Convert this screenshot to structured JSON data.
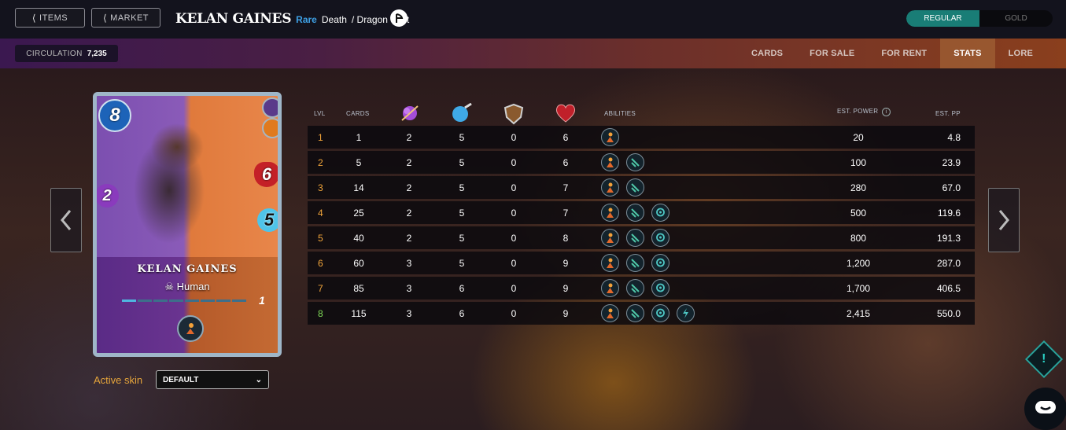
{
  "nav": {
    "items_label": "ITEMS",
    "market_label": "MARKET"
  },
  "card_header": {
    "name": "KELAN GAINES",
    "rarity": "Rare",
    "splinter": "Death",
    "secondary_splinter": "/ Dragon",
    "type": "Unit"
  },
  "edition_toggle": {
    "regular_label": "REGULAR",
    "gold_label": "GOLD",
    "selected": "REGULAR"
  },
  "circulation": {
    "label": "CIRCULATION",
    "value": "7,235"
  },
  "tabs": [
    {
      "label": "CARDS",
      "active": false
    },
    {
      "label": "FOR SALE",
      "active": false
    },
    {
      "label": "FOR RENT",
      "active": false
    },
    {
      "label": "STATS",
      "active": true
    },
    {
      "label": "LORE",
      "active": false
    }
  ],
  "card": {
    "name": "KELAN GAINES",
    "race": "Human",
    "mana": "8",
    "attack": "2",
    "health": "6",
    "speed": "5",
    "level": "1"
  },
  "skin": {
    "label": "Active skin",
    "value": "DEFAULT"
  },
  "table": {
    "headers": {
      "lvl": "LVL",
      "cards": "CARDS",
      "abilities": "ABILITIES",
      "est_power": "EST. POWER",
      "est_pp": "EST. PP"
    },
    "level_colors": [
      "#f0a43a",
      "#f0a43a",
      "#f0a43a",
      "#f0a43a",
      "#f0a43a",
      "#f0a43a",
      "#f0a43a",
      "#7ed957"
    ],
    "rows": [
      {
        "lvl": "1",
        "cards": "1",
        "mana": "2",
        "speed": "5",
        "armor": "0",
        "health": "6",
        "abilities": [
          "ability-a"
        ],
        "power": "20",
        "pp": "4.8"
      },
      {
        "lvl": "2",
        "cards": "5",
        "mana": "2",
        "speed": "5",
        "armor": "0",
        "health": "6",
        "abilities": [
          "ability-a",
          "ability-b"
        ],
        "power": "100",
        "pp": "23.9"
      },
      {
        "lvl": "3",
        "cards": "14",
        "mana": "2",
        "speed": "5",
        "armor": "0",
        "health": "7",
        "abilities": [
          "ability-a",
          "ability-b"
        ],
        "power": "280",
        "pp": "67.0"
      },
      {
        "lvl": "4",
        "cards": "25",
        "mana": "2",
        "speed": "5",
        "armor": "0",
        "health": "7",
        "abilities": [
          "ability-a",
          "ability-b",
          "ability-c"
        ],
        "power": "500",
        "pp": "119.6"
      },
      {
        "lvl": "5",
        "cards": "40",
        "mana": "2",
        "speed": "5",
        "armor": "0",
        "health": "8",
        "abilities": [
          "ability-a",
          "ability-b",
          "ability-c"
        ],
        "power": "800",
        "pp": "191.3"
      },
      {
        "lvl": "6",
        "cards": "60",
        "mana": "3",
        "speed": "5",
        "armor": "0",
        "health": "9",
        "abilities": [
          "ability-a",
          "ability-b",
          "ability-c"
        ],
        "power": "1,200",
        "pp": "287.0"
      },
      {
        "lvl": "7",
        "cards": "85",
        "mana": "3",
        "speed": "6",
        "armor": "0",
        "health": "9",
        "abilities": [
          "ability-a",
          "ability-b",
          "ability-c"
        ],
        "power": "1,700",
        "pp": "406.5"
      },
      {
        "lvl": "8",
        "cards": "115",
        "mana": "3",
        "speed": "6",
        "armor": "0",
        "health": "9",
        "abilities": [
          "ability-a",
          "ability-b",
          "ability-c",
          "ability-d"
        ],
        "power": "2,415",
        "pp": "550.0"
      }
    ]
  }
}
